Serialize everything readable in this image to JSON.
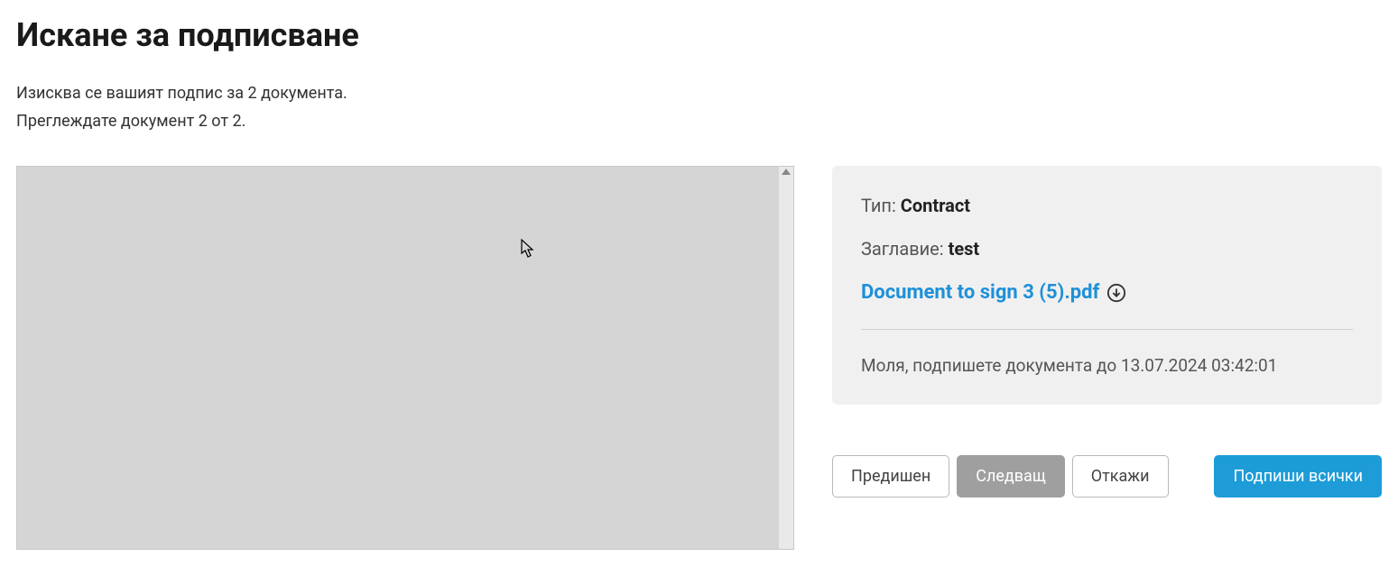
{
  "header": {
    "title": "Искане за подписване",
    "line1": "Изисква се вашият подпис за 2 документа.",
    "line2": "Преглеждате документ 2 от 2."
  },
  "info": {
    "type_label": "Тип: ",
    "type_value": "Contract",
    "title_label": "Заглавие: ",
    "title_value": "test",
    "doc_link": "Document to sign 3 (5).pdf",
    "deadline": "Моля, подпишете документа до 13.07.2024 03:42:01"
  },
  "buttons": {
    "prev": "Предишен",
    "next": "Следващ",
    "cancel": "Откажи",
    "sign_all": "Подпиши всички"
  }
}
